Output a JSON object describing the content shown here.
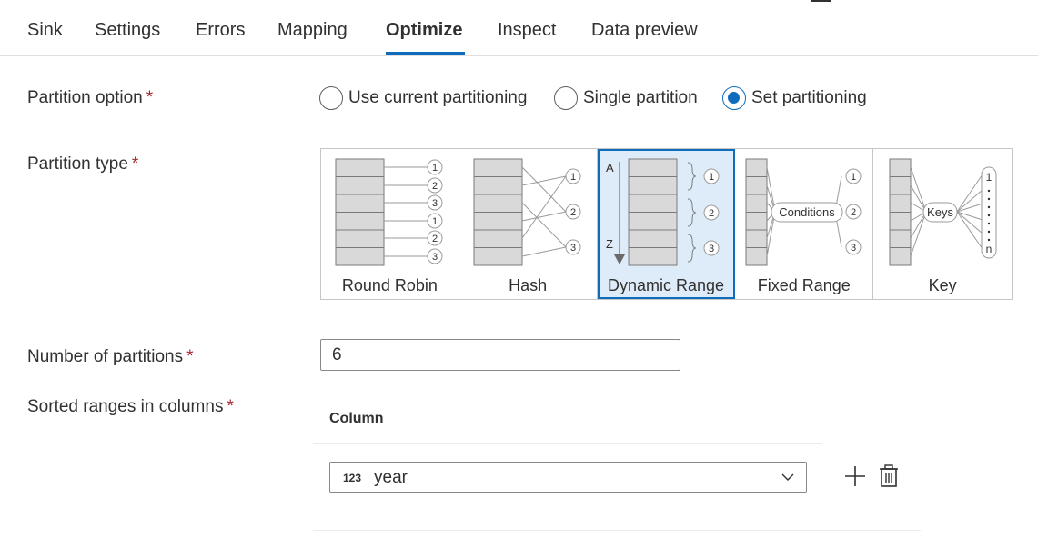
{
  "tabs": [
    {
      "label": "Sink",
      "active": false
    },
    {
      "label": "Settings",
      "active": false
    },
    {
      "label": "Errors",
      "active": false
    },
    {
      "label": "Mapping",
      "active": false
    },
    {
      "label": "Optimize",
      "active": true
    },
    {
      "label": "Inspect",
      "active": false
    },
    {
      "label": "Data preview",
      "active": false
    }
  ],
  "partition_option": {
    "label": "Partition option",
    "required": "*",
    "options": [
      {
        "label": "Use current partitioning",
        "checked": false
      },
      {
        "label": "Single partition",
        "checked": false
      },
      {
        "label": "Set partitioning",
        "checked": true
      }
    ]
  },
  "partition_type": {
    "label": "Partition type",
    "required": "*",
    "types": [
      {
        "label": "Round Robin",
        "selected": false
      },
      {
        "label": "Hash",
        "selected": false
      },
      {
        "label": "Dynamic Range",
        "selected": true
      },
      {
        "label": "Fixed Range",
        "selected": false
      },
      {
        "label": "Key",
        "selected": false
      }
    ],
    "illustration_text": {
      "round_robin_numbers": [
        "1",
        "2",
        "3",
        "1",
        "2",
        "3"
      ],
      "hash_numbers": [
        "1",
        "2",
        "3"
      ],
      "dynamic_range_start": "A",
      "dynamic_range_end": "Z",
      "dynamic_range_numbers": [
        "1",
        "2",
        "3"
      ],
      "fixed_range_box": "Conditions",
      "fixed_range_numbers": [
        "1",
        "2",
        "3"
      ],
      "key_box": "Keys",
      "key_first": "1",
      "key_last": "n"
    }
  },
  "number_of_partitions": {
    "label": "Number of partitions",
    "required": "*",
    "value": "6"
  },
  "sorted_ranges": {
    "label": "Sorted ranges in columns",
    "required": "*",
    "column_header": "Column",
    "rows": [
      {
        "type_badge": "123",
        "value": "year"
      }
    ]
  },
  "colors": {
    "accent": "#0f6cbd",
    "required": "#a4262c",
    "selected_bg": "#deecf9",
    "text": "#323130"
  },
  "icons": [
    "radio-icon",
    "chevron-down-icon",
    "add-icon",
    "delete-icon"
  ]
}
